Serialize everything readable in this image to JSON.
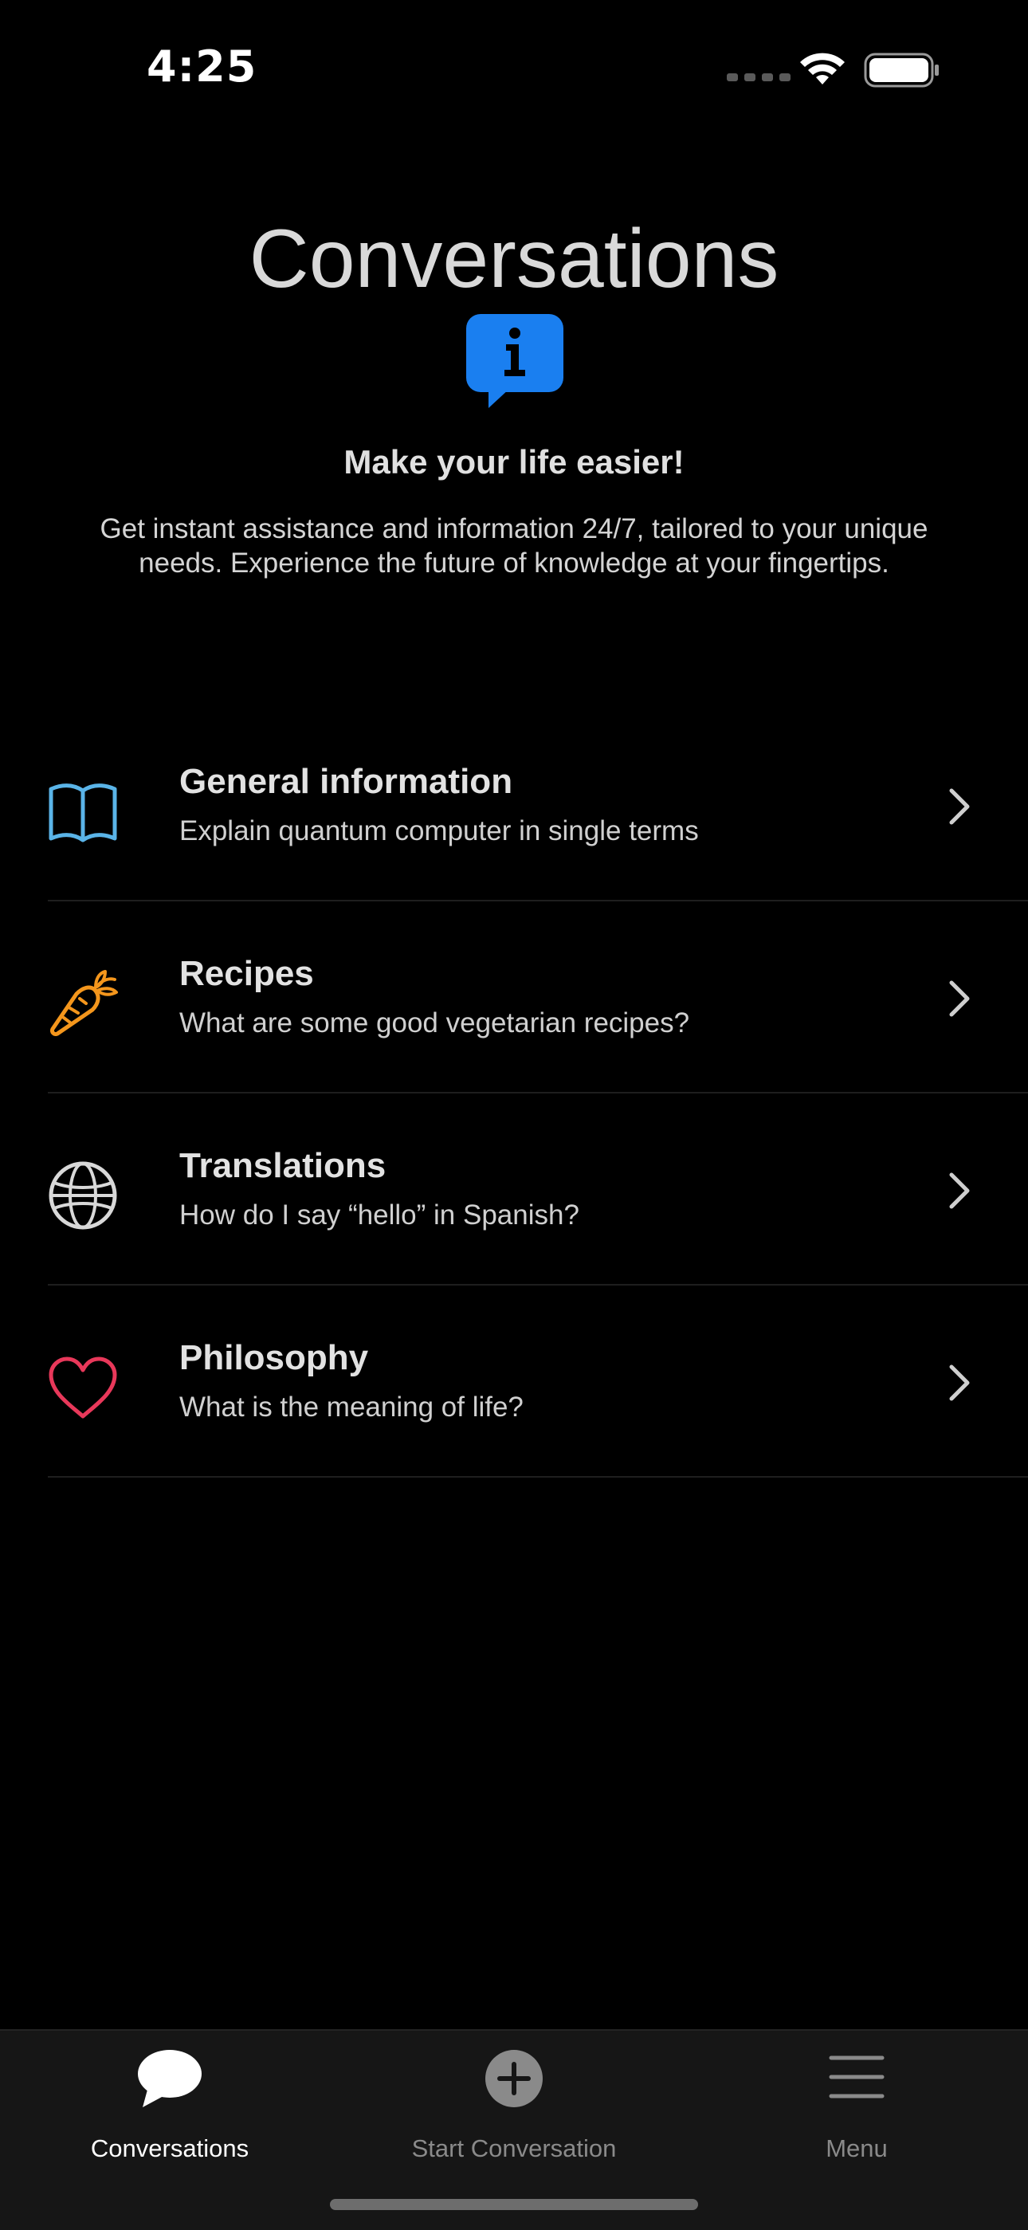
{
  "status_bar": {
    "time": "4:25"
  },
  "header": {
    "title": "Conversations",
    "hero_heading": "Make your life easier!",
    "hero_description": "Get instant assistance and information 24/7, tailored to your unique needs. Experience the future of knowledge at your fingertips."
  },
  "topics": [
    {
      "title": "General information",
      "subtitle": "Explain quantum computer in single terms",
      "icon": "book-icon",
      "color": "#5ab4e8"
    },
    {
      "title": "Recipes",
      "subtitle": "What are some good vegetarian recipes?",
      "icon": "carrot-icon",
      "color": "#f4961c"
    },
    {
      "title": "Translations",
      "subtitle": "How do I say “hello” in Spanish?",
      "icon": "globe-icon",
      "color": "#d8d8d8"
    },
    {
      "title": "Philosophy",
      "subtitle": "What is the meaning of life?",
      "icon": "heart-icon",
      "color": "#e8385a"
    }
  ],
  "tab_bar": {
    "items": [
      {
        "label": "Conversations",
        "icon": "chat-bubble-icon",
        "active": true
      },
      {
        "label": "Start Conversation",
        "icon": "plus-circle-icon",
        "active": false
      },
      {
        "label": "Menu",
        "icon": "menu-icon",
        "active": false
      }
    ]
  },
  "colors": {
    "background": "#000000",
    "accent": "#1a7ff0",
    "tab_bar_background": "#161616"
  }
}
